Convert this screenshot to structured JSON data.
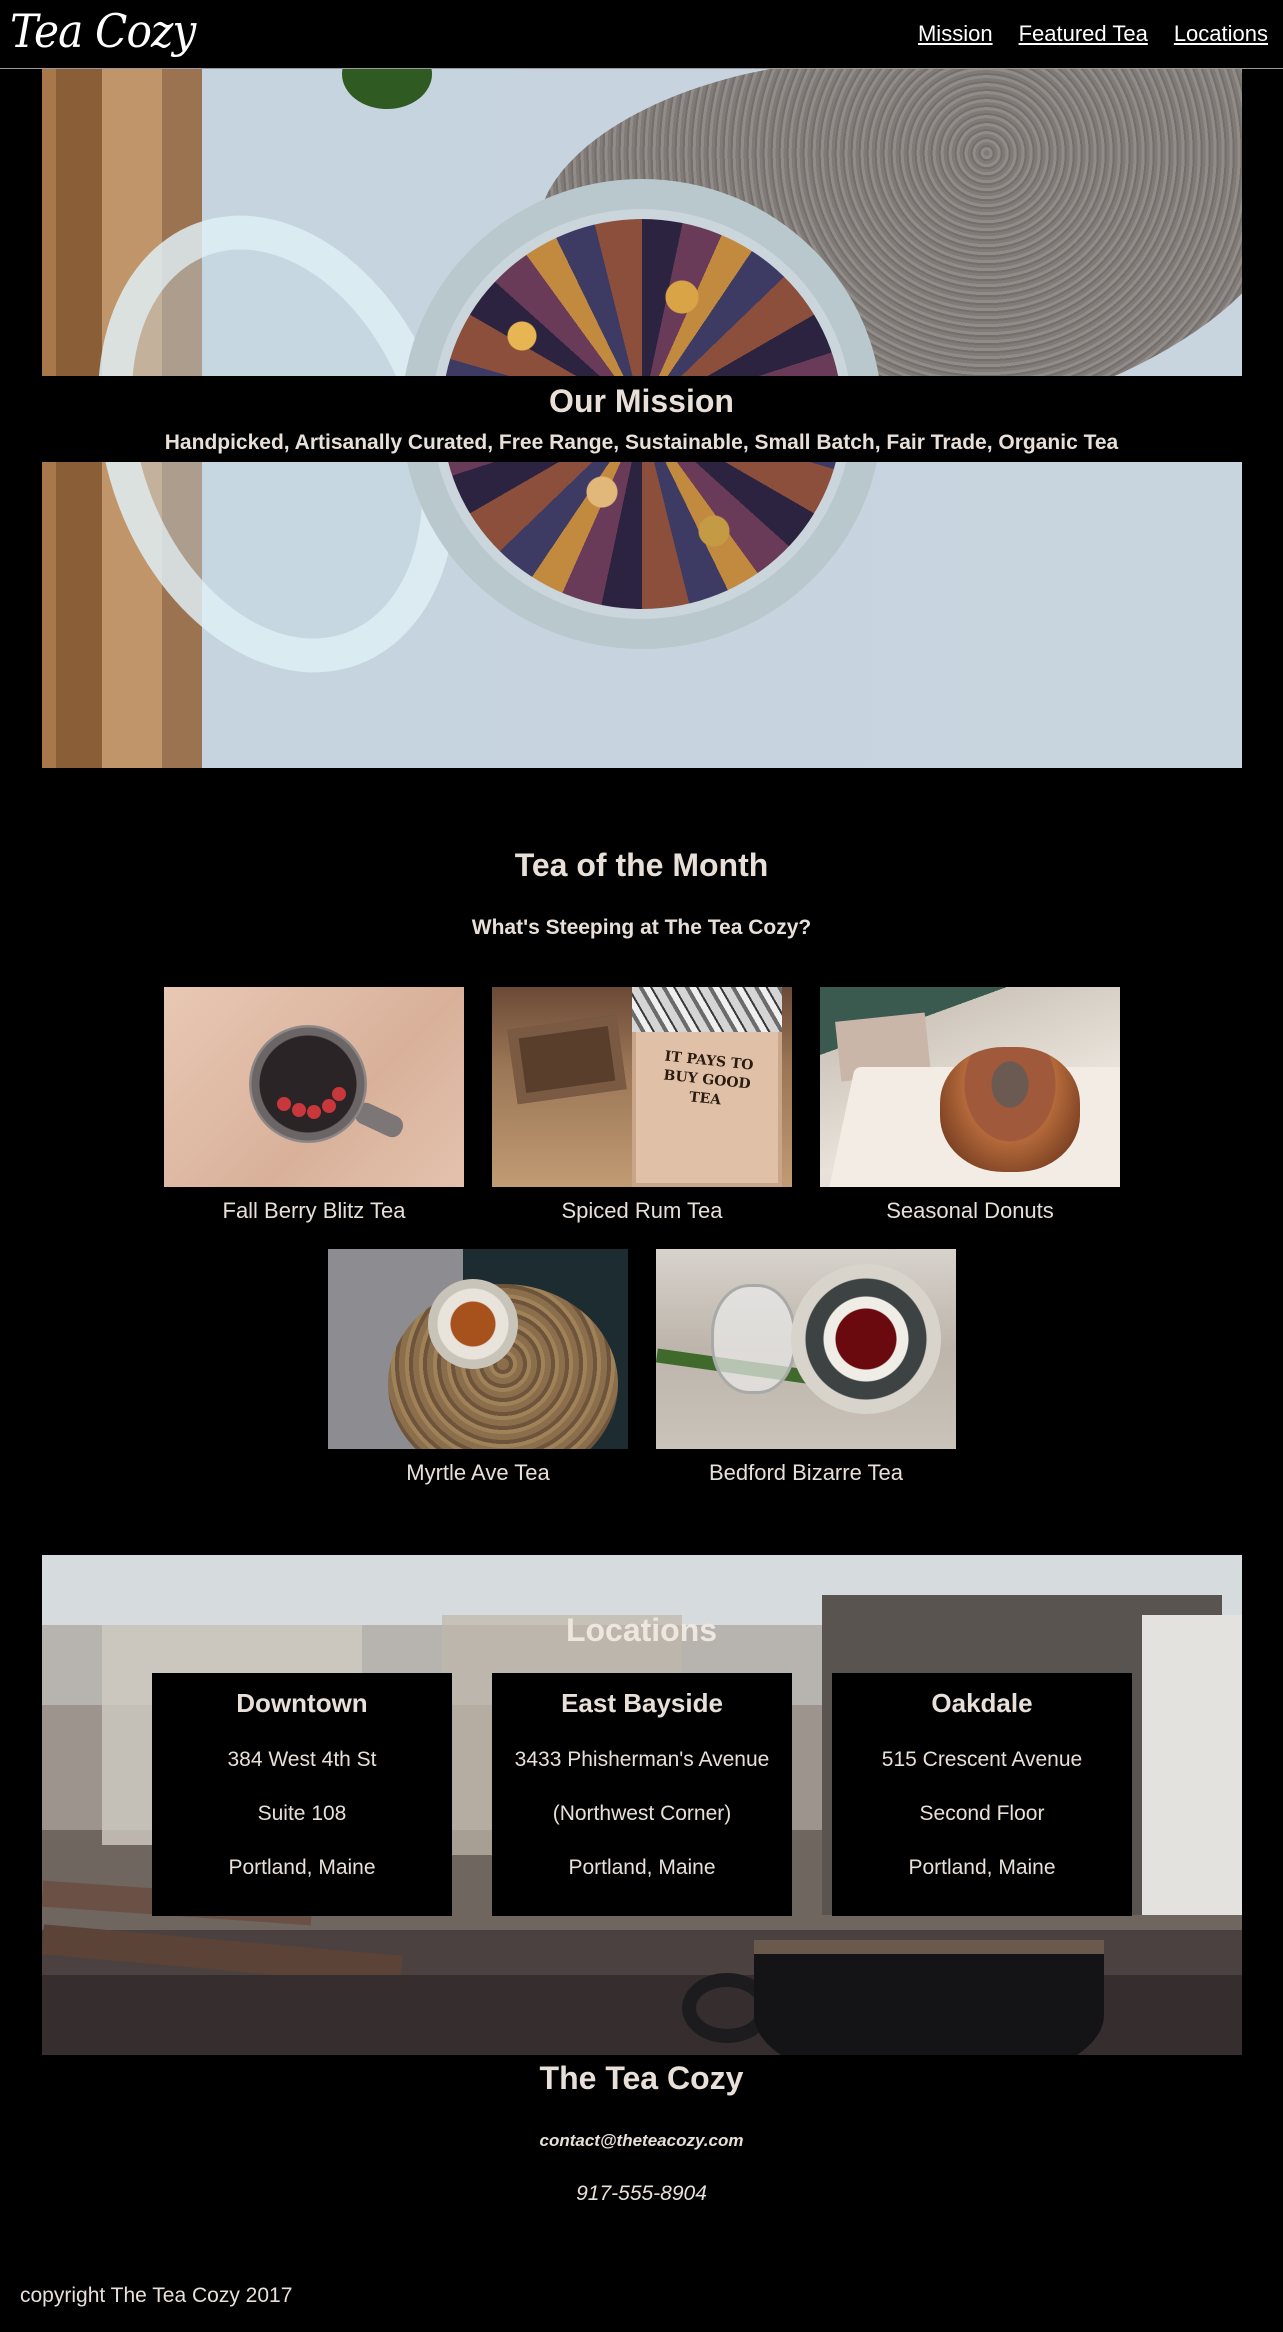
{
  "header": {
    "logo": "Tea Cozy",
    "nav": [
      "Mission",
      "Featured Tea",
      "Locations"
    ]
  },
  "mission": {
    "title": "Our Mission",
    "subtitle": "Handpicked, Artisanally Curated, Free Range, Sustainable, Small Batch, Fair Trade, Organic Tea"
  },
  "tea_of_month": {
    "title": "Tea of the Month",
    "subtitle": "What's Steeping at The Tea Cozy?",
    "items": [
      {
        "name": "Fall Berry Blitz Tea",
        "image": "berry-tea-image"
      },
      {
        "name": "Spiced Rum Tea",
        "image": "spiced-rum-image",
        "image_text": "IT PAYS TO BUY GOOD TEA"
      },
      {
        "name": "Seasonal Donuts",
        "image": "donut-image"
      },
      {
        "name": "Myrtle Ave Tea",
        "image": "myrtle-tea-image"
      },
      {
        "name": "Bedford Bizarre Tea",
        "image": "bedford-tea-image"
      }
    ]
  },
  "locations": {
    "title": "Locations",
    "stores": [
      {
        "name": "Downtown",
        "lines": [
          "384 West 4th St",
          "Suite 108",
          "Portland, Maine"
        ]
      },
      {
        "name": "East Bayside",
        "lines": [
          "3433 Phisherman's Avenue",
          "(Northwest Corner)",
          "Portland, Maine"
        ]
      },
      {
        "name": "Oakdale",
        "lines": [
          "515 Crescent Avenue",
          "Second Floor",
          "Portland, Maine"
        ]
      }
    ]
  },
  "footer": {
    "title": "The Tea Cozy",
    "email": "contact@theteacozy.com",
    "phone": "917-555-8904",
    "copyright": "copyright The Tea Cozy 2017"
  },
  "colors": {
    "background": "#000000",
    "text": "#e8e0d8",
    "nav_link": "#ffffff"
  }
}
